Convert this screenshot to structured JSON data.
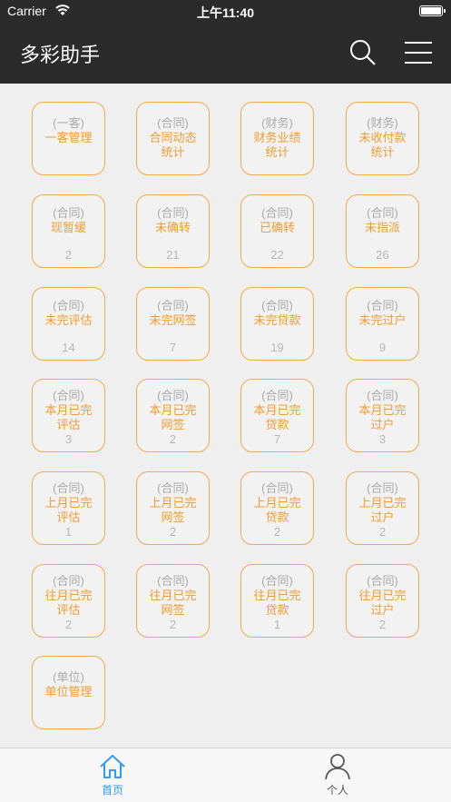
{
  "status_bar": {
    "carrier": "Carrier",
    "time": "上午11:40"
  },
  "nav": {
    "title": "多彩助手"
  },
  "tiles": [
    {
      "cat": "(一客)",
      "name": "一客管理",
      "count": ""
    },
    {
      "cat": "(合同)",
      "name": "合同动态统计",
      "count": ""
    },
    {
      "cat": "(财务)",
      "name": "财务业绩统计",
      "count": ""
    },
    {
      "cat": "(财务)",
      "name": "未收付款统计",
      "count": ""
    },
    {
      "cat": "(合同)",
      "name": "现暂缓",
      "count": "2"
    },
    {
      "cat": "(合同)",
      "name": "未确转",
      "count": "21"
    },
    {
      "cat": "(合同)",
      "name": "已确转",
      "count": "22"
    },
    {
      "cat": "(合同)",
      "name": "未指派",
      "count": "26"
    },
    {
      "cat": "(合同)",
      "name": "未完评估",
      "count": "14"
    },
    {
      "cat": "(合同)",
      "name": "未完网签",
      "count": "7"
    },
    {
      "cat": "(合同)",
      "name": "未完贷款",
      "count": "19"
    },
    {
      "cat": "(合同)",
      "name": "未完过户",
      "count": "9"
    },
    {
      "cat": "(合同)",
      "name": "本月已完评估",
      "count": "3"
    },
    {
      "cat": "(合同)",
      "name": "本月已完网签",
      "count": "2"
    },
    {
      "cat": "(合同)",
      "name": "本月已完贷款",
      "count": "7"
    },
    {
      "cat": "(合同)",
      "name": "本月已完过户",
      "count": "3"
    },
    {
      "cat": "(合同)",
      "name": "上月已完评估",
      "count": "1"
    },
    {
      "cat": "(合同)",
      "name": "上月已完网签",
      "count": "2"
    },
    {
      "cat": "(合同)",
      "name": "上月已完贷款",
      "count": "2"
    },
    {
      "cat": "(合同)",
      "name": "上月已完过户",
      "count": "2"
    },
    {
      "cat": "(合同)",
      "name": "往月已完评估",
      "count": "2"
    },
    {
      "cat": "(合同)",
      "name": "往月已完网签",
      "count": "2"
    },
    {
      "cat": "(合同)",
      "name": "往月已完贷款",
      "count": "1"
    },
    {
      "cat": "(合同)",
      "name": "往月已完过户",
      "count": "2"
    },
    {
      "cat": "(单位)",
      "name": "单位管理",
      "count": ""
    }
  ],
  "tab_bar": {
    "home_label": "首页",
    "me_label": "个人"
  },
  "colors": {
    "accent": "#f19c30",
    "tile_border": "#f5a948",
    "nav_bg": "#2b2b2b",
    "tab_active": "#2f9bf5"
  },
  "icons": {
    "search": "search-icon",
    "menu": "menu-icon",
    "home": "home-icon",
    "person": "person-icon"
  }
}
